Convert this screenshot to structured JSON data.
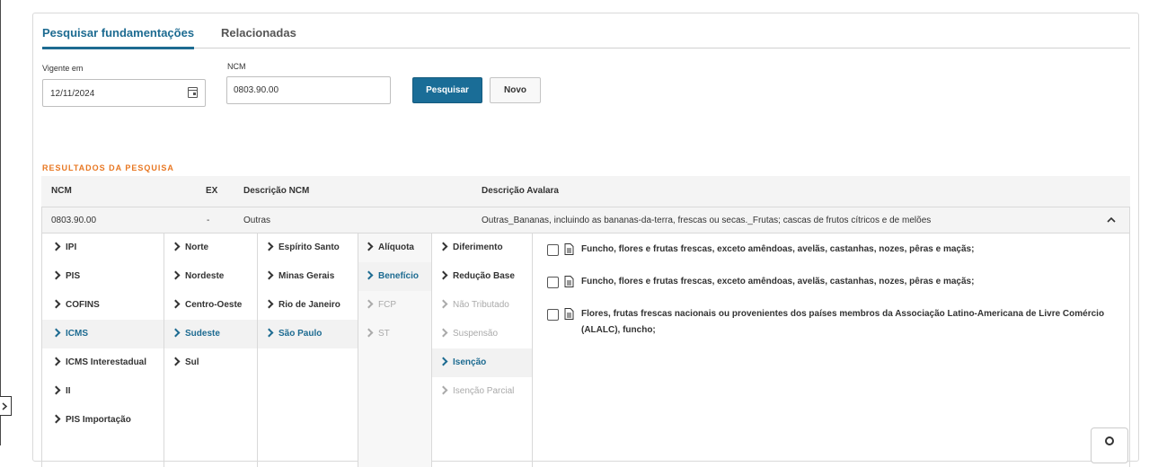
{
  "tabs": [
    {
      "label": "Pesquisar fundamentações",
      "active": true
    },
    {
      "label": "Relacionadas",
      "active": false
    }
  ],
  "search": {
    "vigente_label": "Vigente em",
    "vigente_value": "12/11/2024",
    "ncm_label": "NCM",
    "ncm_value": "0803.90.00",
    "search_button": "Pesquisar",
    "new_button": "Novo"
  },
  "results": {
    "title": "RESULTADOS DA PESQUISA",
    "headers": {
      "ncm": "NCM",
      "ex": "EX",
      "descricao_ncm": "Descrição NCM",
      "descricao_avalara": "Descrição Avalara"
    },
    "row": {
      "ncm": "0803.90.00",
      "ex": "-",
      "descricao_ncm": "Outras",
      "descricao_avalara": "Outras_Bananas, incluindo as bananas-da-terra, frescas ou secas._Frutas; cascas de frutos cítricos e de melões"
    }
  },
  "tree": {
    "tributos": [
      "IPI",
      "PIS",
      "COFINS",
      "ICMS",
      "ICMS Interestadual",
      "II",
      "PIS Importação"
    ],
    "regioes": [
      "Norte",
      "Nordeste",
      "Centro-Oeste",
      "Sudeste",
      "Sul"
    ],
    "estados": [
      "Espírito Santo",
      "Minas Gerais",
      "Rio de Janeiro",
      "São Paulo"
    ],
    "tipos": [
      "Alíquota",
      "Benefício",
      "FCP",
      "ST"
    ],
    "beneficios": [
      "Diferimento",
      "Redução Base",
      "Não Tributado",
      "Suspensão",
      "Isenção",
      "Isenção Parcial"
    ]
  },
  "fundamentacoes": [
    "Funcho, flores e frutas frescas, exceto amêndoas, avelãs, castanhas, nozes, pêras e maçãs;",
    "Funcho, flores e frutas frescas, exceto amêndoas, avelãs, castanhas, nozes, pêras e maçãs;",
    "Flores, frutas frescas nacionais ou provenientes dos países membros da Associação Latino-Americana de Livre Comércio (ALALC), funcho;"
  ],
  "colors": {
    "primary": "#1a6d97",
    "accent": "#e87722",
    "selected": "#1d6b91"
  },
  "icons": [
    "calendar-icon",
    "chevron-right-icon",
    "chevron-up-icon",
    "document-icon",
    "search-icon"
  ]
}
